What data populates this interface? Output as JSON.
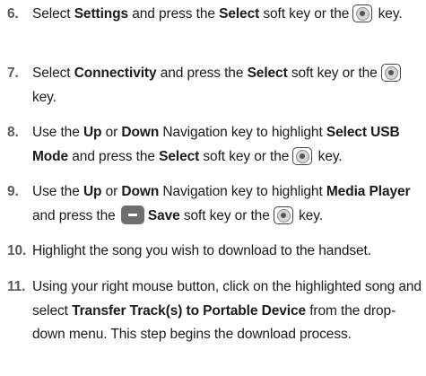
{
  "steps": [
    {
      "number": "6.",
      "segments": [
        {
          "t": "text",
          "v": "Select "
        },
        {
          "t": "bold",
          "v": "Settings"
        },
        {
          "t": "text",
          "v": " and press the "
        },
        {
          "t": "bold",
          "v": "Select"
        },
        {
          "t": "text",
          "v": " soft key or the "
        },
        {
          "t": "key-icon"
        },
        {
          "t": "text",
          "v": " key."
        }
      ]
    },
    {
      "number": "7.",
      "segments": [
        {
          "t": "text",
          "v": "Select "
        },
        {
          "t": "bold",
          "v": "Connectivity"
        },
        {
          "t": "text",
          "v": " and press the "
        },
        {
          "t": "bold",
          "v": "Select"
        },
        {
          "t": "text",
          "v": " soft key or the "
        },
        {
          "t": "key-icon"
        },
        {
          "t": "text",
          "v": " key."
        }
      ]
    },
    {
      "number": "8.",
      "segments": [
        {
          "t": "text",
          "v": "Use the "
        },
        {
          "t": "bold",
          "v": "Up"
        },
        {
          "t": "text",
          "v": " or "
        },
        {
          "t": "bold",
          "v": "Down"
        },
        {
          "t": "text",
          "v": " Navigation key to highlight "
        },
        {
          "t": "bold",
          "v": "Select USB Mode"
        },
        {
          "t": "text",
          "v": " and press the "
        },
        {
          "t": "bold",
          "v": "Select"
        },
        {
          "t": "text",
          "v": " soft key or the "
        },
        {
          "t": "key-icon"
        },
        {
          "t": "text",
          "v": " key."
        }
      ]
    },
    {
      "number": "9.",
      "segments": [
        {
          "t": "text",
          "v": "Use the "
        },
        {
          "t": "bold",
          "v": "Up"
        },
        {
          "t": "text",
          "v": " or "
        },
        {
          "t": "bold",
          "v": "Down"
        },
        {
          "t": "text",
          "v": " Navigation key to highlight "
        },
        {
          "t": "bold",
          "v": "Media Player"
        },
        {
          "t": "text",
          "v": " and press the "
        },
        {
          "t": "soft-icon"
        },
        {
          "t": "bold",
          "v": "Save"
        },
        {
          "t": "text",
          "v": " soft key or the "
        },
        {
          "t": "key-icon"
        },
        {
          "t": "text",
          "v": " key."
        }
      ]
    },
    {
      "number": "10.",
      "segments": [
        {
          "t": "text",
          "v": "Highlight the song you wish to download to the handset."
        }
      ]
    },
    {
      "number": "11.",
      "segments": [
        {
          "t": "text",
          "v": "Using your right mouse button, click on the highlighted song and select "
        },
        {
          "t": "bold",
          "v": "Transfer Track(s) to Portable Device"
        },
        {
          "t": "text",
          "v": " from the drop-down menu. This step begins the download process."
        }
      ]
    }
  ]
}
